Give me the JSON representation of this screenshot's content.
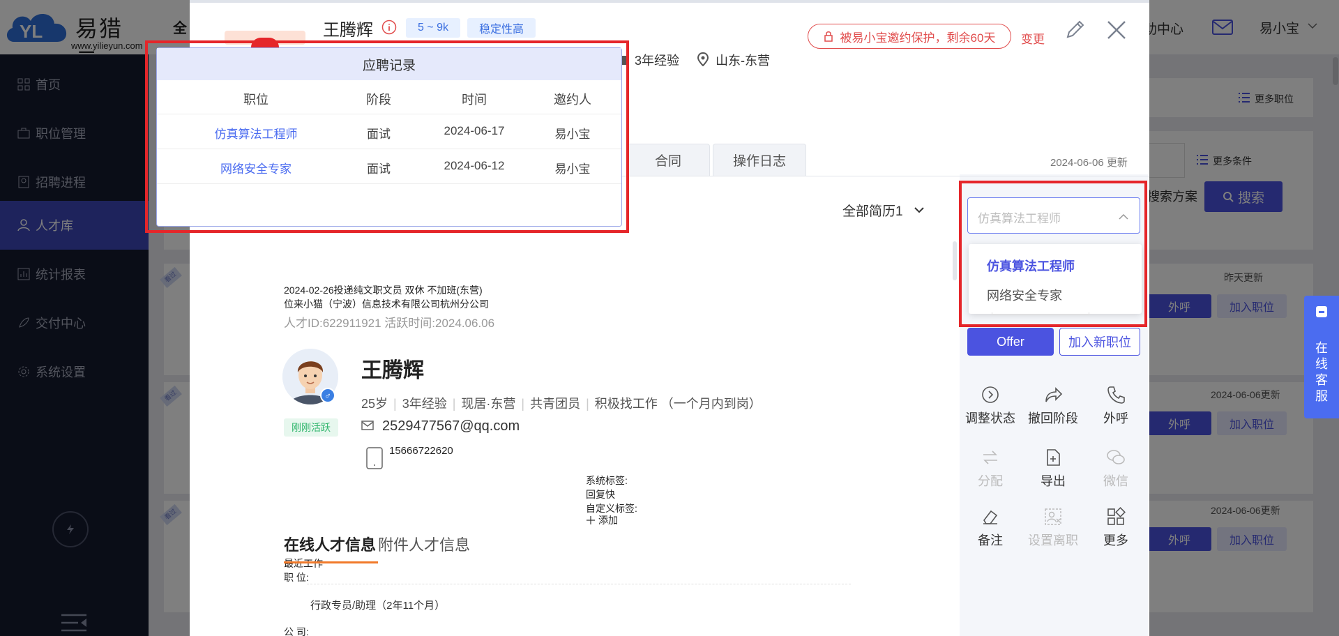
{
  "app": {
    "logo_name": "易猎云",
    "logo_url": "www.yilieyun.com",
    "nav_all": "全",
    "nav_help": "助中心",
    "user_name": "易小宝"
  },
  "sidebar": {
    "items": [
      {
        "label": "首页"
      },
      {
        "label": "职位管理"
      },
      {
        "label": "招聘进程"
      },
      {
        "label": "人才库"
      },
      {
        "label": "统计报表"
      },
      {
        "label": "交付中心"
      },
      {
        "label": "系统设置"
      }
    ]
  },
  "background": {
    "more_positions": "更多职位",
    "more_conditions": "更多条件",
    "search_plan": "搜索方案",
    "search_btn": "搜索",
    "rows": [
      {
        "date": "昨天更新",
        "call": "外呼",
        "add": "加入职位"
      },
      {
        "date": "2024-06-06更新",
        "call": "外呼",
        "add": "加入职位"
      },
      {
        "date": "2024-06-06更新",
        "call": "外呼",
        "add": "加入职位"
      }
    ],
    "ribbon": "看过"
  },
  "service": {
    "label": "在线客服"
  },
  "modal": {
    "name": "王腾辉",
    "tags": [
      "5 ~ 9k",
      "稳定性高"
    ],
    "experience": "3年经验",
    "location": "山东-东营",
    "protect": "被易小宝邀约保护，剩余60天",
    "change": "变更",
    "tabs": [
      "合同",
      "操作日志"
    ],
    "update_date": "2024-06-06 更新",
    "all_resume": "全部简历1"
  },
  "resume": {
    "line1": "2024-02-26投递纯文职文员 双休 不加班(东营)",
    "line2": "位来小猫（宁波）信息技术有限公司杭州分公司",
    "talent_id": "人才ID:622911921 活跃时间:2024.06.06",
    "active_badge": "刚刚活跃",
    "name": "王腾辉",
    "info": [
      "25岁",
      "3年经验",
      "现居·东营",
      "共青团员",
      "积极找工作 （一个月内到岗）"
    ],
    "email": "2529477567@qq.com",
    "phone": "15666722620",
    "sys_tag_label": "系统标签:",
    "sys_tag_value": "回复快",
    "custom_tag_label": "自定义标签:",
    "add_tag": "添加",
    "online_info": "在线人才信息",
    "attach_info": "附件人才信息",
    "recent_work": "最近工作",
    "position_label": "职 位:",
    "position_value": "行政专员/助理（2年11个月）",
    "company_label": "公 司:"
  },
  "right_panel": {
    "select_placeholder": "仿真算法工程师",
    "options": [
      "仿真算法工程师",
      "网络安全专家"
    ],
    "offer": "Offer",
    "add_position": "加入新职位",
    "actions": [
      {
        "label": "调整状态",
        "icon": "arrow-circle-icon",
        "disabled": false
      },
      {
        "label": "撤回阶段",
        "icon": "share-arrow-icon",
        "disabled": false
      },
      {
        "label": "外呼",
        "icon": "phone-icon",
        "disabled": false
      },
      {
        "label": "分配",
        "icon": "swap-icon",
        "disabled": true
      },
      {
        "label": "导出",
        "icon": "file-plus-icon",
        "disabled": false
      },
      {
        "label": "微信",
        "icon": "wechat-icon",
        "disabled": true
      },
      {
        "label": "备注",
        "icon": "eraser-icon",
        "disabled": false
      },
      {
        "label": "设置离职",
        "icon": "person-x-icon",
        "disabled": true
      },
      {
        "label": "更多",
        "icon": "grid-icon",
        "disabled": false
      }
    ]
  },
  "popup": {
    "title": "应聘记录",
    "headers": [
      "职位",
      "阶段",
      "时间",
      "邀约人"
    ],
    "rows": [
      {
        "position": "仿真算法工程师",
        "stage": "面试",
        "time": "2024-06-17",
        "inviter": "易小宝"
      },
      {
        "position": "网络安全专家",
        "stage": "面试",
        "time": "2024-06-12",
        "inviter": "易小宝"
      }
    ]
  },
  "colors": {
    "accent": "#4b53e0",
    "danger": "#e5262a",
    "sidebar": "#141a2e"
  }
}
